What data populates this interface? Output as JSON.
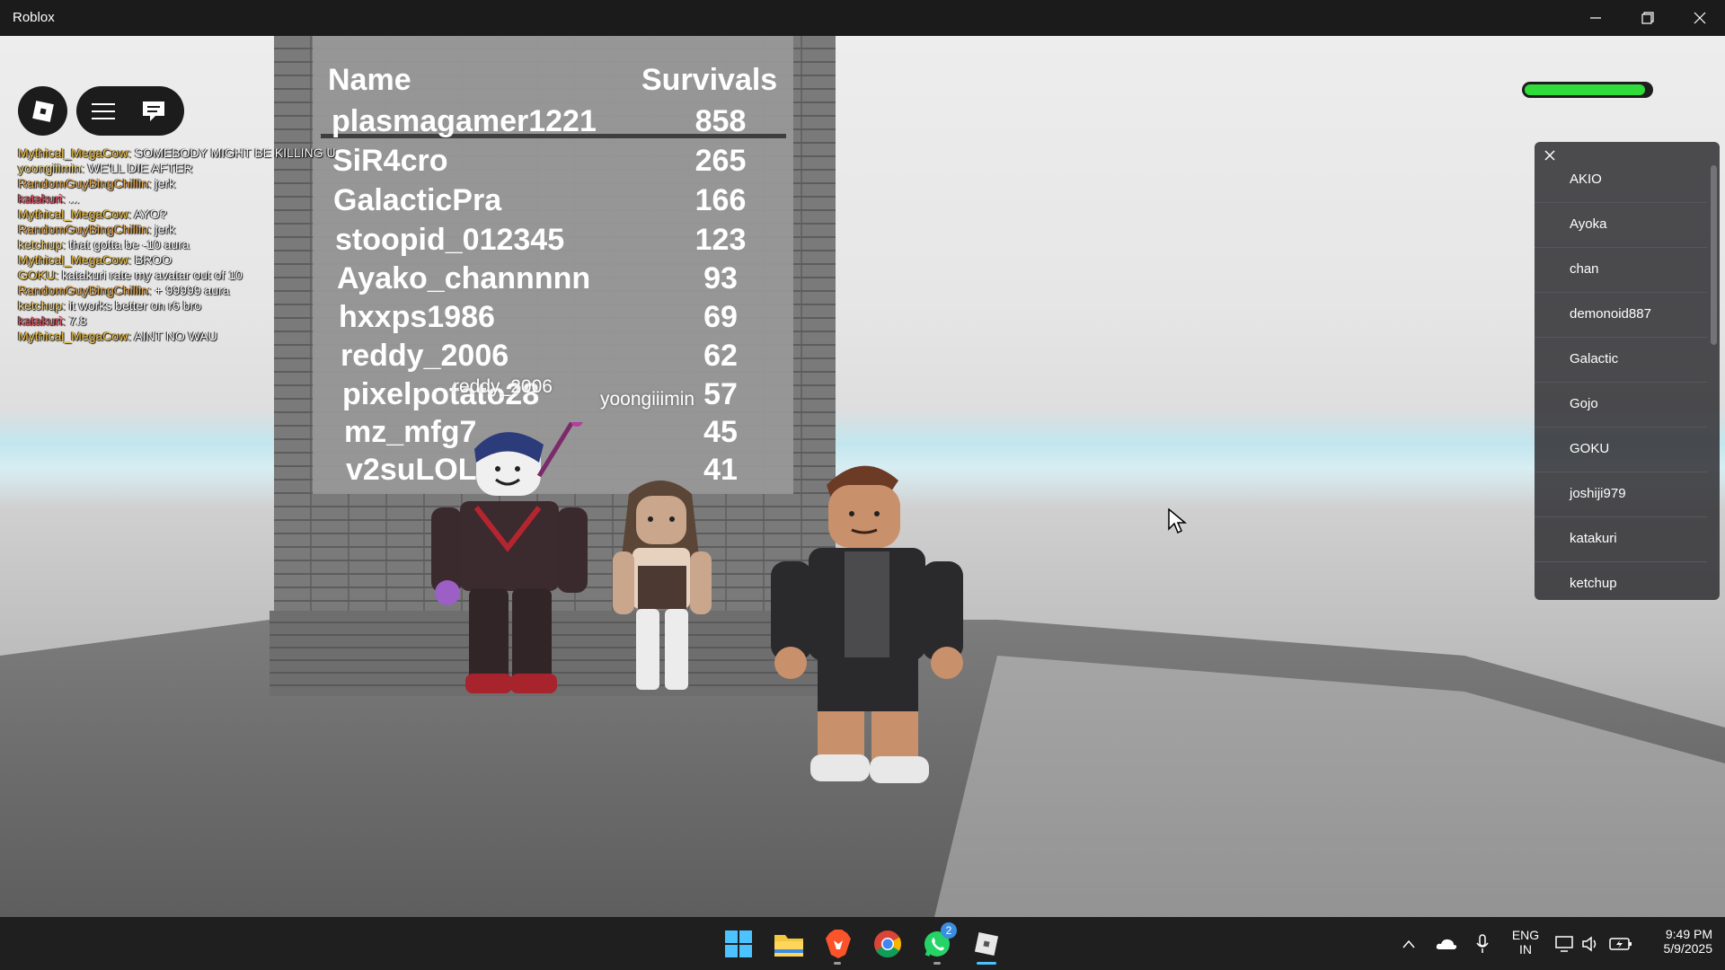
{
  "window": {
    "title": "Roblox"
  },
  "leaderboard": {
    "header_name": "Name",
    "header_score": "Survivals",
    "rows": [
      {
        "name": "plasmagamer1221",
        "score": "858"
      },
      {
        "name": "SiR4cro",
        "score": "265"
      },
      {
        "name": "GalacticPra",
        "score": "166"
      },
      {
        "name": "stoopid_012345",
        "score": "123"
      },
      {
        "name": "Ayako_channnnn",
        "score": "93"
      },
      {
        "name": "hxxps1986",
        "score": "69"
      },
      {
        "name": "reddy_2006",
        "score": "62"
      },
      {
        "name": "pixelpotato28",
        "score": "57"
      },
      {
        "name": "mz_mfg7",
        "score": "45"
      },
      {
        "name": "v2suLOL",
        "score": "41"
      }
    ]
  },
  "nametags": {
    "left": "reddy_2006",
    "middle": "yoongiiimin"
  },
  "chat": [
    {
      "name": "Mythical_MegaCow:",
      "color": "#f5c542",
      "text": "SOMEBODY MIGHT BE KILLING U"
    },
    {
      "name": "yoongiiimin:",
      "color": "#f5d77a",
      "text": "WE'LL DIE AFTER"
    },
    {
      "name": "RandomGuyBingChillin:",
      "color": "#e8a94a",
      "text": "jerk"
    },
    {
      "name": "katakuri:",
      "color": "#f04e5e",
      "text": "..."
    },
    {
      "name": "Mythical_MegaCow:",
      "color": "#f5c542",
      "text": "AYO?"
    },
    {
      "name": "RandomGuyBingChillin:",
      "color": "#e8a94a",
      "text": "jerk"
    },
    {
      "name": "ketchup:",
      "color": "#f5d77a",
      "text": "that gotta be -10 aura"
    },
    {
      "name": "Mythical_MegaCow:",
      "color": "#f5c542",
      "text": "BROO"
    },
    {
      "name": "GOKU:",
      "color": "#f5c542",
      "text": "katakuri rate my avatar out of 10"
    },
    {
      "name": "RandomGuyBingChillin:",
      "color": "#e8a94a",
      "text": "+ 99999 aura"
    },
    {
      "name": "ketchup:",
      "color": "#f5d77a",
      "text": "it works better on r6 bro"
    },
    {
      "name": "katakuri:",
      "color": "#f04e5e",
      "text": "7.8"
    },
    {
      "name": "Mythical_MegaCow:",
      "color": "#f5c542",
      "text": "AINT NO WAU"
    }
  ],
  "health": {
    "fraction": 0.96,
    "color": "#2fdc3a"
  },
  "players": [
    "AKIO",
    "Ayoka",
    "chan",
    "demonoid887",
    "Galactic",
    "Gojo",
    "GOKU",
    "joshiji979",
    "katakuri",
    "ketchup"
  ],
  "taskbar": {
    "whatsapp_badge": "2",
    "language": "ENG",
    "region": "IN",
    "time": "9:49 PM",
    "date": "5/9/2025"
  }
}
